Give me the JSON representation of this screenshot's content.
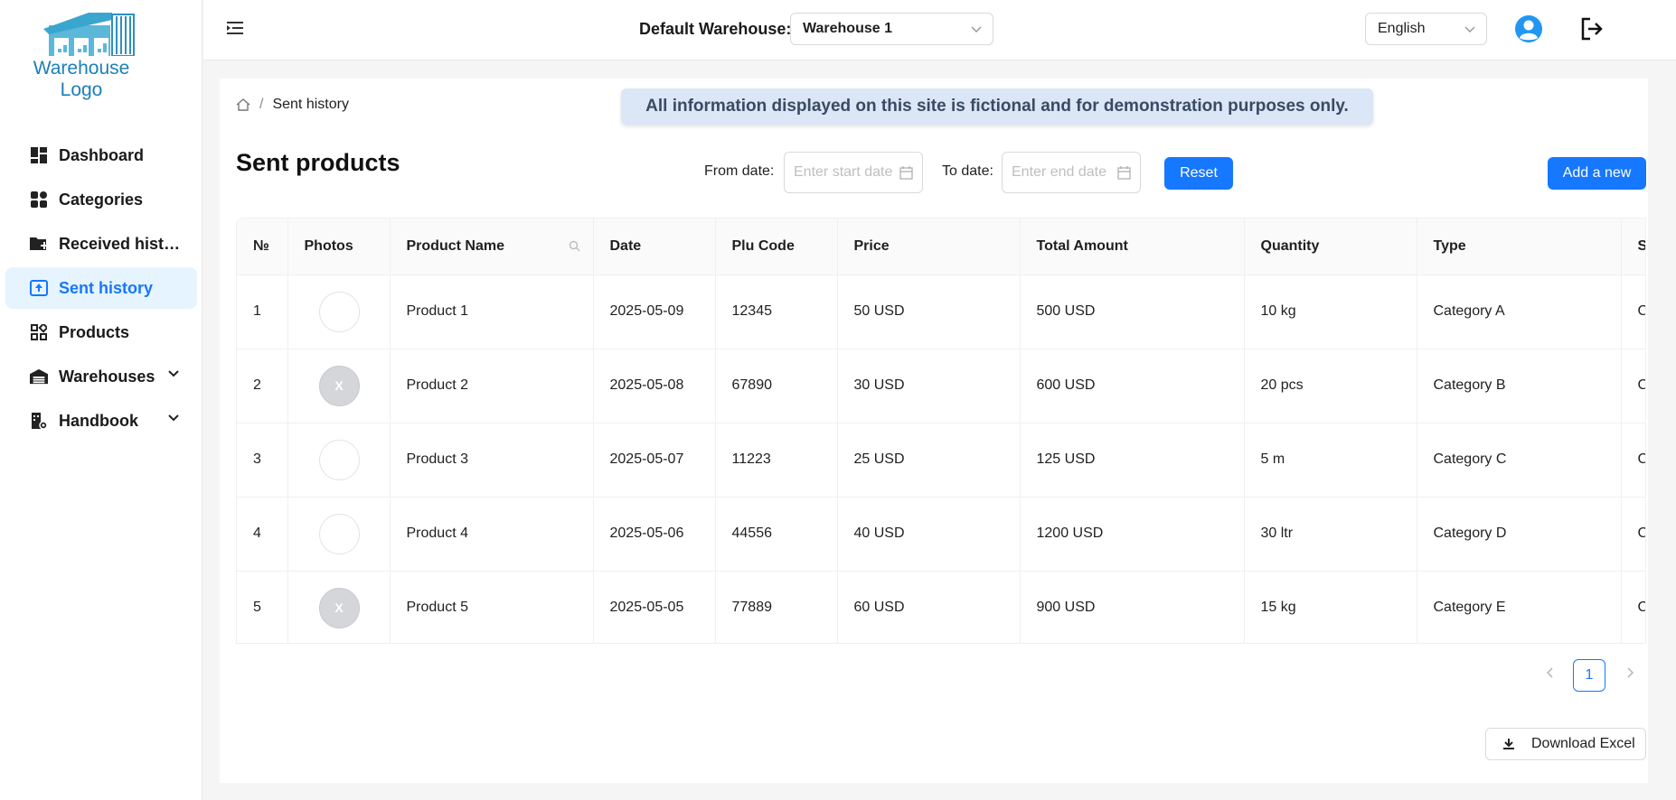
{
  "logo": {
    "text": "Warehouse Logo"
  },
  "sidebar": {
    "items": [
      {
        "label": "Dashboard",
        "icon": "dashboard-icon",
        "active": false
      },
      {
        "label": "Categories",
        "icon": "grid-icon",
        "active": false
      },
      {
        "label": "Received histo...",
        "icon": "folder-plus-icon",
        "active": false
      },
      {
        "label": "Sent history",
        "icon": "upload-box-icon",
        "active": true
      },
      {
        "label": "Products",
        "icon": "apps-icon",
        "active": false
      },
      {
        "label": "Warehouses",
        "icon": "warehouse-icon",
        "active": false,
        "expandable": true
      },
      {
        "label": "Handbook",
        "icon": "building-gear-icon",
        "active": false,
        "expandable": true
      }
    ]
  },
  "header": {
    "default_warehouse_label": "Default Warehouse:",
    "warehouse_value": "Warehouse 1",
    "language_value": "English"
  },
  "breadcrumb": {
    "current": "Sent history"
  },
  "notice": "All information displayed on this site is fictional and for demonstration purposes only.",
  "page_title": "Sent products",
  "filters": {
    "from_label": "From date:",
    "from_placeholder": "Enter start date",
    "to_label": "To date:",
    "to_placeholder": "Enter end date",
    "reset_label": "Reset",
    "add_label": "Add a new"
  },
  "table": {
    "columns": [
      "№",
      "Photos",
      "Product Name",
      "Date",
      "Plu Code",
      "Price",
      "Total Amount",
      "Quantity",
      "Type",
      "S"
    ],
    "rows": [
      {
        "no": "1",
        "photo": "",
        "name": "Product 1",
        "date": "2025-05-09",
        "plu": "12345",
        "price": "50 USD",
        "total": "500 USD",
        "qty": "10 kg",
        "type": "Category A",
        "extra": "C"
      },
      {
        "no": "2",
        "photo": "X",
        "name": "Product 2",
        "date": "2025-05-08",
        "plu": "67890",
        "price": "30 USD",
        "total": "600 USD",
        "qty": "20 pcs",
        "type": "Category B",
        "extra": "C"
      },
      {
        "no": "3",
        "photo": "",
        "name": "Product 3",
        "date": "2025-05-07",
        "plu": "11223",
        "price": "25 USD",
        "total": "125 USD",
        "qty": "5 m",
        "type": "Category C",
        "extra": "C"
      },
      {
        "no": "4",
        "photo": "",
        "name": "Product 4",
        "date": "2025-05-06",
        "plu": "44556",
        "price": "40 USD",
        "total": "1200 USD",
        "qty": "30 ltr",
        "type": "Category D",
        "extra": "C"
      },
      {
        "no": "5",
        "photo": "X",
        "name": "Product 5",
        "date": "2025-05-05",
        "plu": "77889",
        "price": "60 USD",
        "total": "900 USD",
        "qty": "15 kg",
        "type": "Category E",
        "extra": "C"
      }
    ]
  },
  "pagination": {
    "current_page": "1"
  },
  "download_label": "Download Excel",
  "colors": {
    "primary": "#1677ff",
    "active_bg": "#e6f4ff",
    "notice_bg": "#dbe7f7",
    "logo_blue": "#1c7fb8"
  }
}
